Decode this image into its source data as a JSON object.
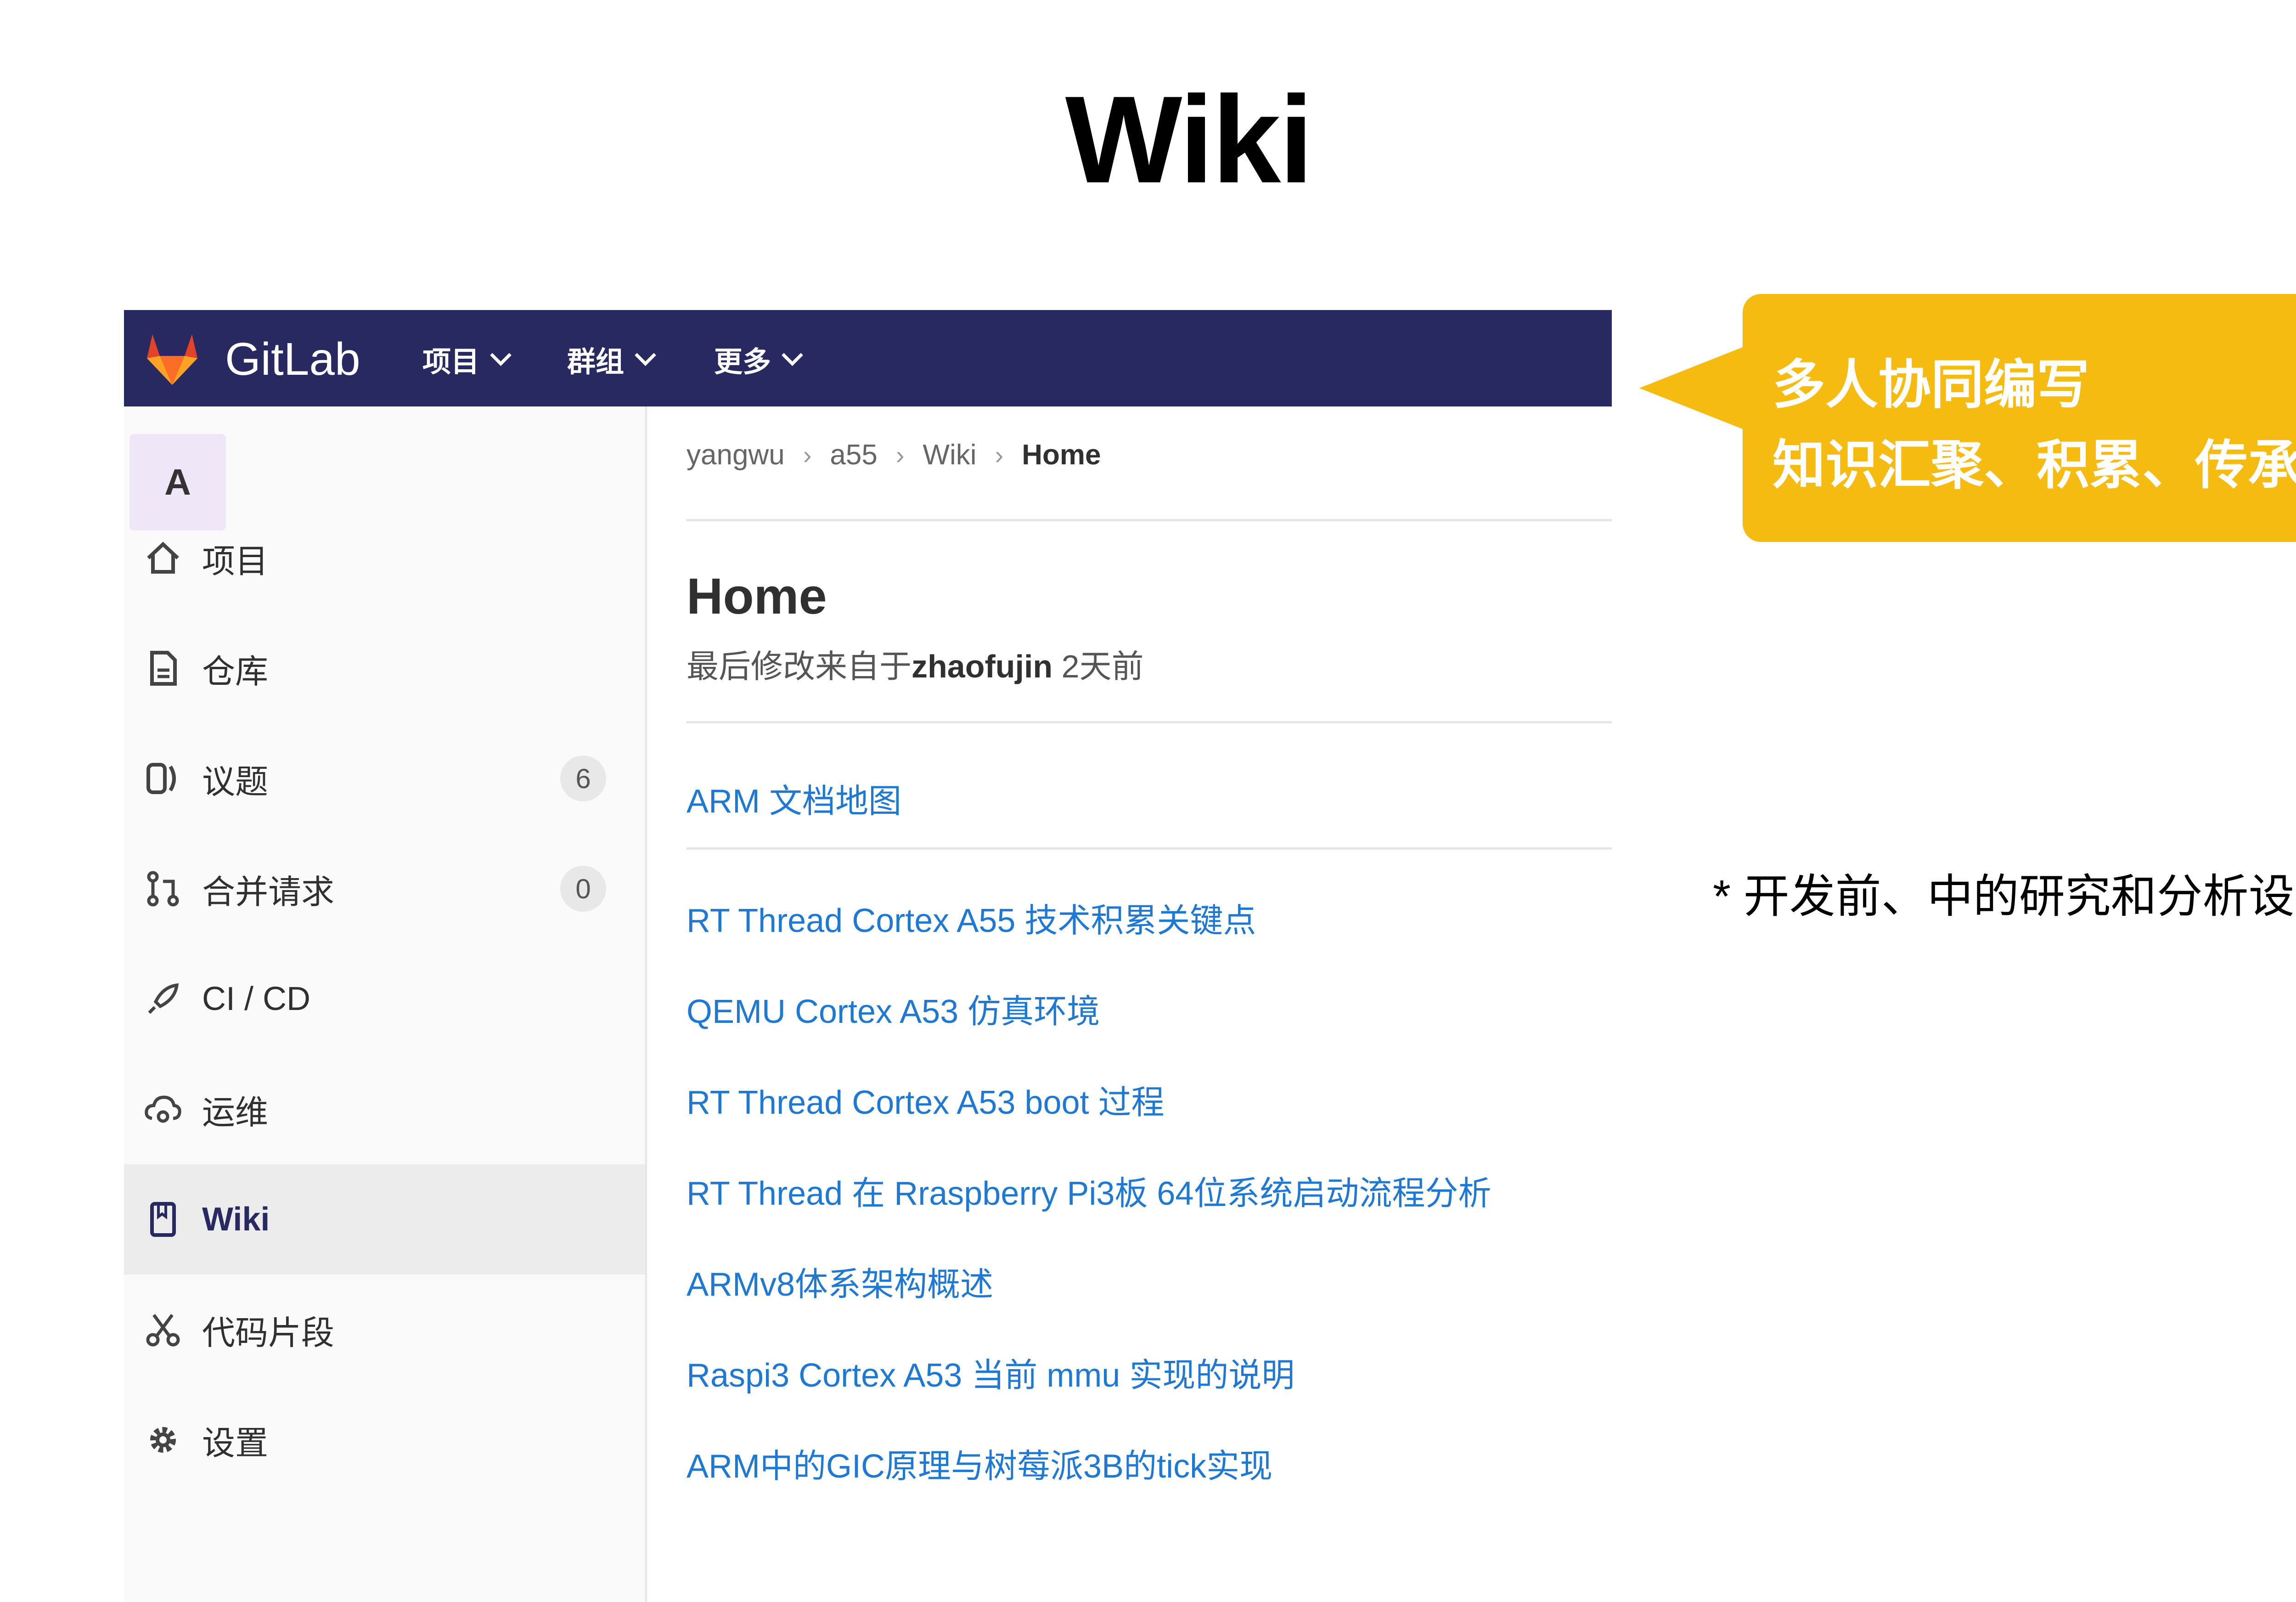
{
  "slide": {
    "title": "Wiki"
  },
  "topbar": {
    "brand": "GitLab",
    "nav": [
      {
        "label": "项目"
      },
      {
        "label": "群组"
      },
      {
        "label": "更多"
      }
    ]
  },
  "sidebar": {
    "avatar_letter": "A",
    "items": [
      {
        "label": "项目",
        "icon": "home-icon"
      },
      {
        "label": "仓库",
        "icon": "document-icon"
      },
      {
        "label": "议题",
        "icon": "issues-icon",
        "badge": "6"
      },
      {
        "label": "合并请求",
        "icon": "merge-request-icon",
        "badge": "0"
      },
      {
        "label": "CI / CD",
        "icon": "rocket-icon"
      },
      {
        "label": "运维",
        "icon": "cloud-gear-icon"
      },
      {
        "label": "Wiki",
        "icon": "book-icon",
        "active": true
      },
      {
        "label": "代码片段",
        "icon": "scissors-icon"
      },
      {
        "label": "设置",
        "icon": "gear-icon"
      }
    ]
  },
  "breadcrumb": [
    "yangwu",
    "a55",
    "Wiki",
    "Home"
  ],
  "page": {
    "title": "Home",
    "meta_prefix": "最后修改来自于",
    "meta_author": "zhaofujin",
    "meta_suffix": " 2天前"
  },
  "wiki_links": [
    "ARM 文档地图",
    "RT Thread Cortex A55 技术积累关键点",
    "QEMU Cortex A53 仿真环境",
    "RT Thread Cortex A53 boot 过程",
    "RT Thread 在 Rraspberry Pi3板 64位系统启动流程分析",
    "ARMv8体系架构概述",
    "Raspi3 Cortex A53 当前 mmu 实现的说明",
    "ARM中的GIC原理与树莓派3B的tick实现"
  ],
  "callout": {
    "line1": "多人协同编写",
    "line2": "知识汇聚、积累、传承"
  },
  "note": "*  开发前、中的研究和分析设计",
  "colors": {
    "topbar": "#292961",
    "link": "#1f78d1",
    "callout": "#f6bb10"
  }
}
